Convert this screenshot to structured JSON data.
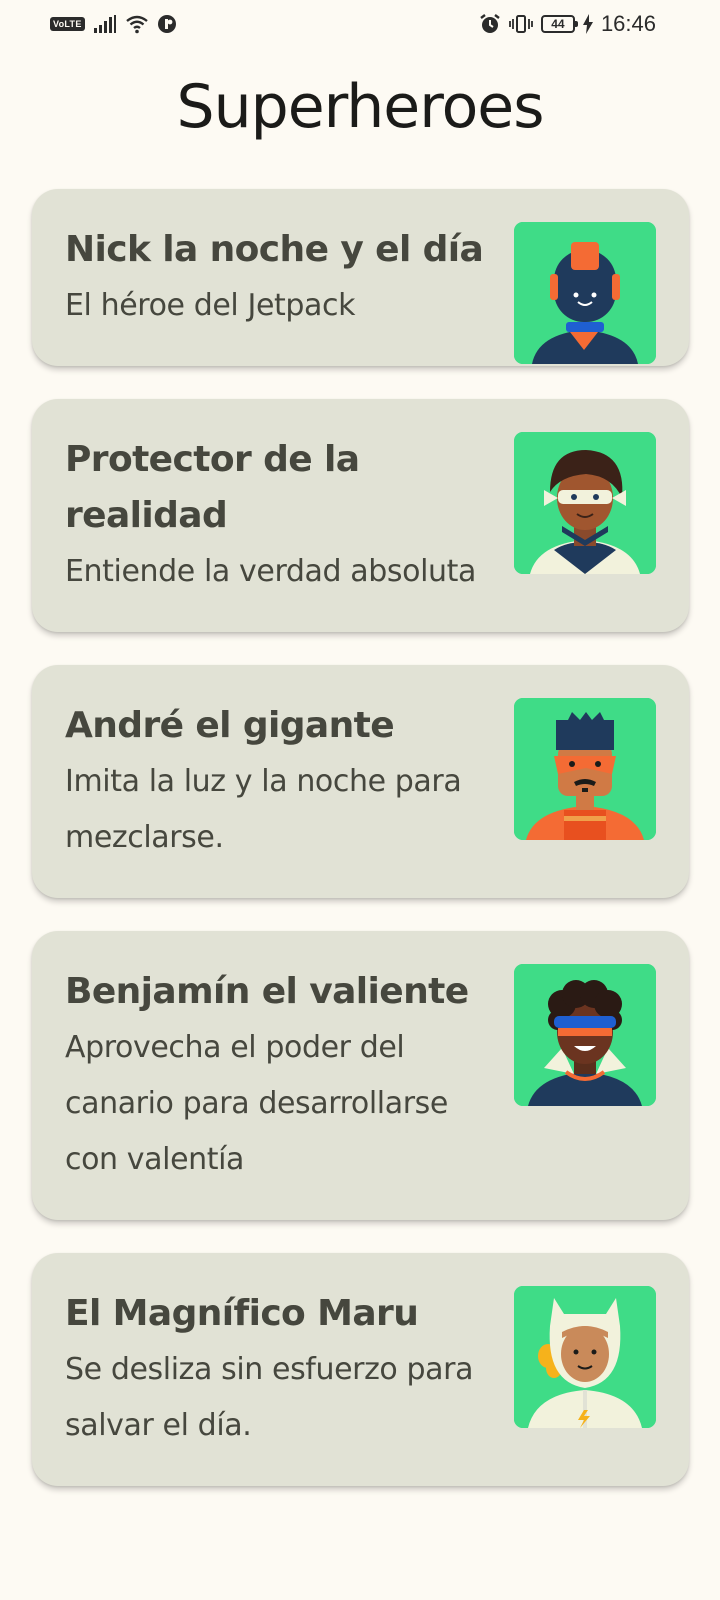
{
  "status_bar": {
    "volte": "VoLTE",
    "battery": "44",
    "time": "16:46"
  },
  "title": "Superheroes",
  "heroes": [
    {
      "name": "Nick la noche y el día",
      "description": "El héroe del Jetpack",
      "avatar_icon": "jetpack-hero-avatar"
    },
    {
      "name": "Protector de la realidad",
      "description": "Entiende la verdad absoluta",
      "avatar_icon": "masked-hero-avatar"
    },
    {
      "name": "André el gigante",
      "description": "Imita la luz y la noche para mezclarse.",
      "avatar_icon": "orange-hero-avatar"
    },
    {
      "name": "Benjamín el valiente",
      "description": "Aprovecha el poder del canario para desarrollarse con valentía",
      "avatar_icon": "visor-hero-avatar"
    },
    {
      "name": "El Magnífico Maru",
      "description": "Se desliza sin esfuerzo para salvar el día.",
      "avatar_icon": "hooded-hero-avatar"
    }
  ],
  "colors": {
    "background": "#fdfaf3",
    "card": "#e1e2d5",
    "avatar_bg": "#3fdc87",
    "text": "#46473e"
  }
}
